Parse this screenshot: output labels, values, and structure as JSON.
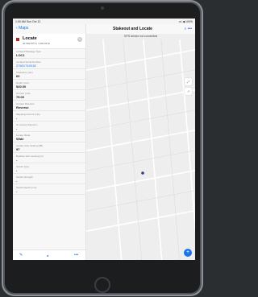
{
  "status_bar": {
    "time": "1:00 AM  Sun Oct 12",
    "right": "••• ◀ 100%"
  },
  "nav": {
    "back_label": "Maps"
  },
  "feature": {
    "title": "Locate",
    "coords": "40.681787°N, 3.901787E",
    "close_glyph": "✕"
  },
  "attributes": [
    {
      "label": "Located Message Type",
      "value": "LOC1",
      "link": false
    },
    {
      "label": "Located Serial Number",
      "value": "27601742018",
      "link": true
    },
    {
      "label": "Frequency (Hz)",
      "value": "60",
      "link": false
    },
    {
      "label": "Depth (mm)",
      "value": "$40.00",
      "link": false
    },
    {
      "label": "Current (mA)",
      "value": "75.00",
      "link": false
    },
    {
      "label": "Current Direction",
      "value": "Reverse",
      "link": false
    },
    {
      "label": "Mapping Current (mA)",
      "value": "-",
      "link": false
    },
    {
      "label": "UI Current Direction",
      "value": "-",
      "link": false
    },
    {
      "label": "Locate Mode",
      "value": "Wide",
      "link": false
    },
    {
      "label": "Locate Core Setting (dB)",
      "value": "97",
      "link": false
    },
    {
      "label": "Relative Vert Leaning (m)",
      "value": "-",
      "link": false
    },
    {
      "label": "Sonde Type",
      "value": "-",
      "link": false
    },
    {
      "label": "Sonde Strength",
      "value": "-",
      "link": false
    },
    {
      "label": "Sonde Depth (mm)",
      "value": "-",
      "link": false
    }
  ],
  "toolbar": {
    "edit_icon": "✎",
    "locate_icon": "●",
    "more_icon": "•••"
  },
  "map_header": {
    "title": "Stakeout and Locate",
    "icons": "⌕  •••"
  },
  "map": {
    "banner": "GPS device not connected",
    "zoom_icon": "⤢",
    "compass_icon": "↗",
    "fab_icon": "+"
  },
  "colors": {
    "accent": "#1a73e8",
    "symbol": "#b3261e"
  }
}
